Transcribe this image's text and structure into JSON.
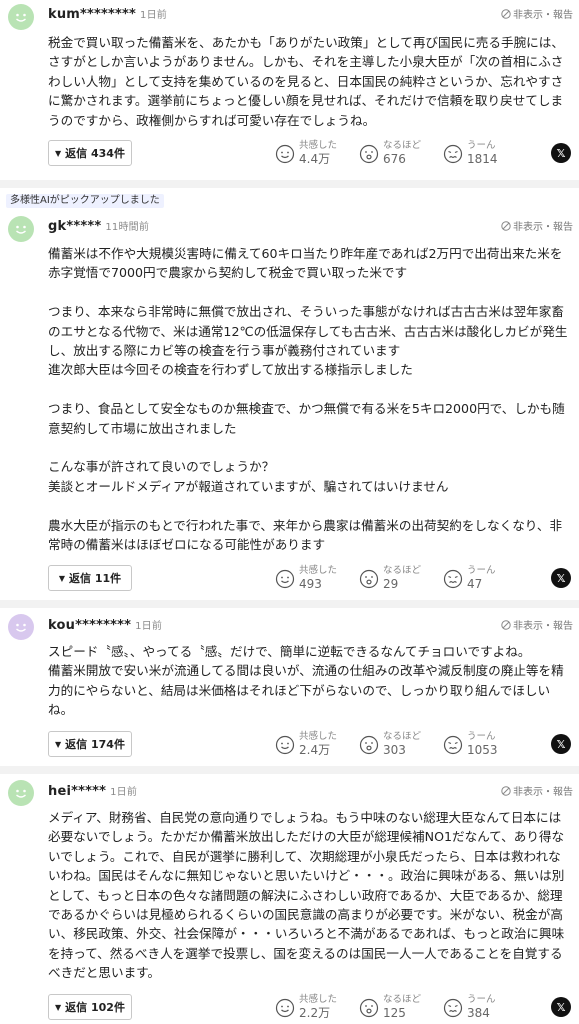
{
  "report_label": "非表示・報告",
  "reaction_labels": {
    "empathy": "共感した",
    "insight": "なるほど",
    "hmm": "うーん"
  },
  "pick_badge": "多様性AIがピックアップしました",
  "comments": [
    {
      "user": "kum********",
      "time": "1日前",
      "body": "税金で買い取った備蓄米を、あたかも「ありがたい政策」として再び国民に売る手腕には、さすがとしか言いようがありません。しかも、それを主導した小泉大臣が「次の首相にふさわしい人物」として支持を集めているのを見ると、日本国民の純粋さというか、忘れやすさに驚かされます。選挙前にちょっと優しい顔を見せれば、それだけで信頼を取り戻せてしまうのですから、政権側からすれば可愛い存在でしょうね。",
      "reply": "返信 434件",
      "empathy": "4.4万",
      "insight": "676",
      "hmm": "1814"
    },
    {
      "user": "gk*****",
      "time": "11時間前",
      "body": "備蓄米は不作や大規模災害時に備えて60キロ当たり昨年産であれば2万円で出荷出来た米を赤字覚悟で7000円で農家から契約して税金で買い取った米です\n\nつまり、本来なら非常時に無償で放出され、そういった事態がなければ古古古米は翌年家畜のエサとなる代物で、米は通常12℃の低温保存しても古古米、古古古米は酸化しカビが発生し、放出する際にカビ等の検査を行う事が義務付されています\n進次郎大臣は今回その検査を行わずして放出する様指示しました\n\nつまり、食品として安全なものか無検査で、かつ無償で有る米を5キロ2000円で、しかも随意契約して市場に放出されました\n\nこんな事が許されて良いのでしょうか？\n美談とオールドメディアが報道されていますが、騙されてはいけません\n\n農水大臣が指示のもとで行われた事で、来年から農家は備蓄米の出荷契約をしなくなり、非常時の備蓄米はほぼゼロになる可能性があります",
      "reply": "返信 11件",
      "empathy": "493",
      "insight": "29",
      "hmm": "47"
    },
    {
      "user": "kou********",
      "time": "1日前",
      "body": "スピード〝感〟、やってる〝感〟だけで、簡単に逆転できるなんてチョロいですよね。\n備蓄米開放で安い米が流通してる間は良いが、流通の仕組みの改革や減反制度の廃止等を精力的にやらないと、結局は米価格はそれほど下がらないので、しっかり取り組んでほしいね。",
      "reply": "返信 174件",
      "empathy": "2.4万",
      "insight": "303",
      "hmm": "1053"
    },
    {
      "user": "hei*****",
      "time": "1日前",
      "body": "メディア、財務省、自民党の意向通りでしょうね。もう中味のない総理大臣なんて日本には必要ないでしょう。たかだか備蓄米放出しただけの大臣が総理候補NO1だなんて、あり得ないでしょう。これで、自民が選挙に勝利して、次期総理が小泉氏だったら、日本は救われないわね。国民はそんなに無知じゃないと思いたいけど・・・。政治に興味がある、無いは別として、もっと日本の色々な諸問題の解決にふさわしい政府であるか、大臣であるか、総理であるかぐらいは見極められるくらいの国民意識の高まりが必要です。米がない、税金が高い、移民政策、外交、社会保障が・・・いろいろと不満があるであれば、もっと政治に興味を持って、然るべき人を選挙で投票し、国を変えるのは国民一人一人であることを自覚するべきだと思います。",
      "reply": "返信 102件",
      "empathy": "2.2万",
      "insight": "125",
      "hmm": "384"
    }
  ],
  "colors": {
    "avatar_green": "#b9e3b4",
    "avatar_purple": "#d8c8ee",
    "badge_bg": "#eef1ff"
  },
  "icons": {
    "avatar": "smiley-avatar-icon",
    "report": "hide-report-icon",
    "x": "x-share-icon"
  }
}
